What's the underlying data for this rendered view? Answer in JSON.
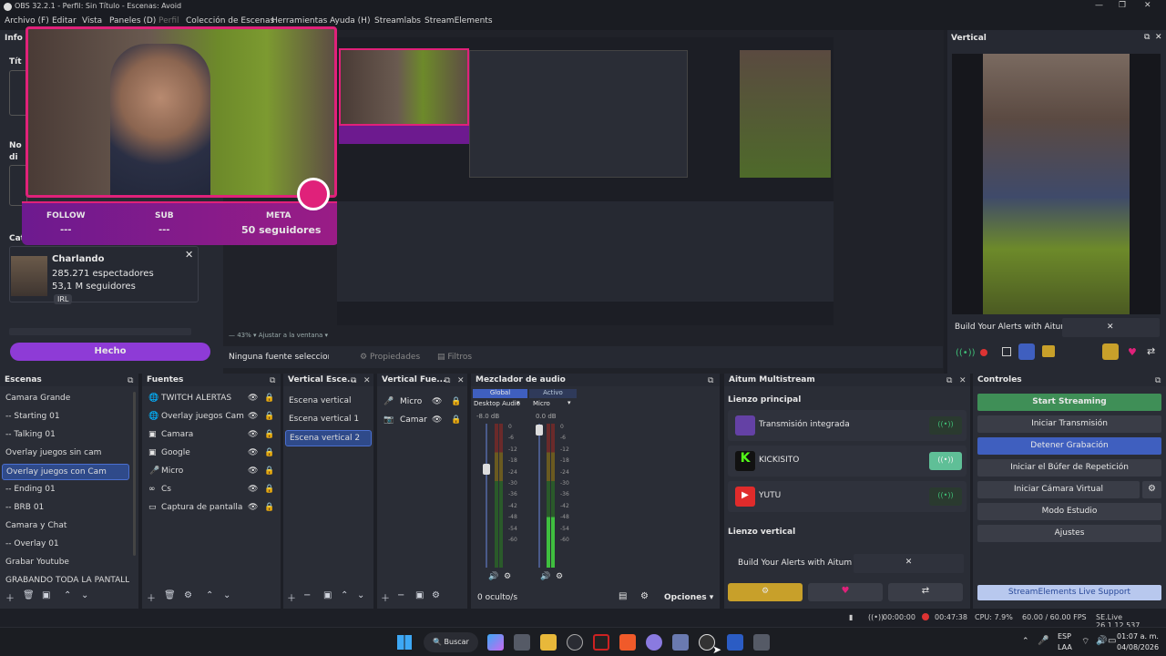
{
  "window": {
    "title": "OBS 32.2.1 - Perfil: Sin Título - Escenas: Avoid"
  },
  "menu": [
    "Archivo (F)",
    "Editar",
    "Vista",
    "Paneles (D)",
    "Perfil",
    "Colección de Escenas",
    "Herramientas",
    "Ayuda (H)",
    "Streamlabs",
    "StreamElements"
  ],
  "info_panel": {
    "label": "Info",
    "frag1": "Tít",
    "frag2": "No",
    "frag3": "di",
    "category_label": "Categoría",
    "channel": {
      "name": "Charlando",
      "viewers": "285.271 espectadores",
      "followers": "53,1 M seguidores",
      "tag": "IRL"
    },
    "done_button": "Hecho"
  },
  "overlay": {
    "follow_label": "FOLLOW",
    "follow_value": "---",
    "sub_label": "SUB",
    "sub_value": "---",
    "goal_label": "META",
    "goal_value": "50 seguidores"
  },
  "preview": {
    "no_source": "Ninguna fuente seleccionad",
    "properties": "Propiedades",
    "filters": "Filtros"
  },
  "vertical_panel": {
    "title": "Vertical",
    "banner": "Build Your Alerts with Aitum"
  },
  "scenes": {
    "title": "Escenas",
    "items": [
      "Camara Grande",
      "-- Starting 01",
      "-- Talking 01",
      "Overlay juegos sin cam",
      "Overlay juegos con Cam",
      "-- Ending 01",
      "-- BRB 01",
      "Camara y Chat",
      "-- Overlay 01",
      "Grabar Youtube",
      "GRABANDO TODA LA PANTALLA"
    ],
    "selected": "Overlay juegos con Cam"
  },
  "sources": {
    "title": "Fuentes",
    "items": [
      "TWITCH ALERTAS",
      "Overlay juegos Cam",
      "Camara",
      "Google",
      "Micro",
      "Cs",
      "Captura de pantalla"
    ]
  },
  "vertical_scenes": {
    "title": "Vertical Esce...",
    "items": [
      "Escena vertical",
      "Escena vertical 1",
      "Escena vertical 2"
    ],
    "selected": "Escena vertical 2"
  },
  "vertical_sources": {
    "title": "Vertical Fue...",
    "items": [
      "Micro",
      "Camar"
    ]
  },
  "mixer": {
    "title": "Mezclador de audio",
    "tab_global": "Global",
    "tab_active": "Activo",
    "ch1": "Desktop Audio",
    "ch2": "Micro",
    "db1": "-8.0 dB",
    "db2": "0.0 dB",
    "scale": [
      "0",
      "-6",
      "-12",
      "-18",
      "-24",
      "-30",
      "-36",
      "-42",
      "-48",
      "-54",
      "-60"
    ],
    "hidden": "0 oculto/s",
    "options": "Opciones"
  },
  "aitum": {
    "title": "Aitum Multistream",
    "main_canvas": "Lienzo principal",
    "outputs": [
      "Transmisión integrada",
      "KICKISITO",
      "YUTU"
    ],
    "vertical_canvas": "Lienzo vertical",
    "banner": "Build Your Alerts with Aitum"
  },
  "controls": {
    "title": "Controles",
    "start_streaming": "Start Streaming",
    "buttons": [
      "Iniciar Transmisión",
      "Detener Grabación",
      "Iniciar el Búfer de Repetición",
      "Iniciar Cámara Virtual",
      "Modo Estudio",
      "Ajustes"
    ],
    "se_support": "StreamElements Live Support"
  },
  "statusbar": {
    "t1": "00:00:00",
    "t2": "00:47:38",
    "cpu": "CPU: 7.9%",
    "fps": "60.00 / 60.00 FPS",
    "version": "SE.Live 26.1.12.537"
  },
  "taskbar": {
    "search": "Buscar",
    "lang": "ESP",
    "lang2": "LAA",
    "time": "01:07 a. m.",
    "date": "04/08/2026"
  },
  "colors": {
    "accent": "#3f5fbf",
    "start_stream": "#3f8f57",
    "overlay_pink": "#e0217a",
    "overlay_purple": "#6d1a8f",
    "done": "#8e3bd6"
  }
}
